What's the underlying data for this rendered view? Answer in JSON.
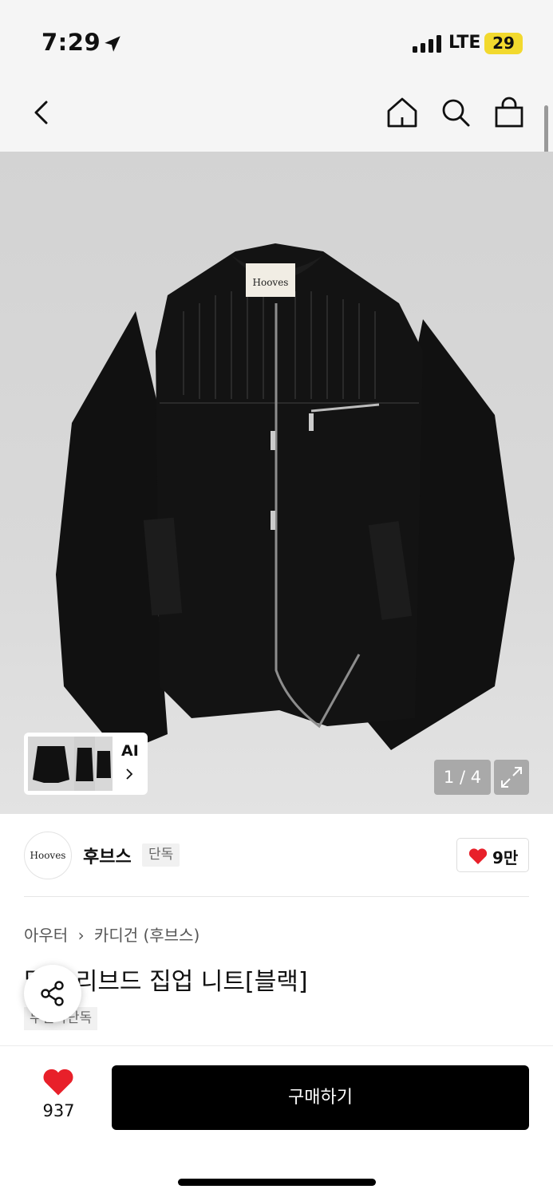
{
  "status_bar": {
    "time": "7:29",
    "network": "LTE",
    "battery": "29",
    "battery_color": "#f2d92e"
  },
  "nav": {
    "icons": [
      "back-arrow-icon",
      "home-icon",
      "search-icon",
      "shopping-bag-icon"
    ]
  },
  "gallery": {
    "counter": "1 / 4",
    "ai_label": "AI",
    "garment_label": "Hooves",
    "expand_icon": "expand-icon"
  },
  "brand": {
    "logo_text": "Hooves",
    "name": "후브스",
    "badge": "단독",
    "likes": "9만",
    "like_color": "#e8202a"
  },
  "product": {
    "breadcrumb": [
      "아우터",
      "카디건 (후브스)"
    ],
    "title": "멀티 리브드 집업 니트[블랙]",
    "tag": "무신사단독"
  },
  "bottom_bar": {
    "wish_count": "937",
    "buy_label": "구매하기"
  }
}
